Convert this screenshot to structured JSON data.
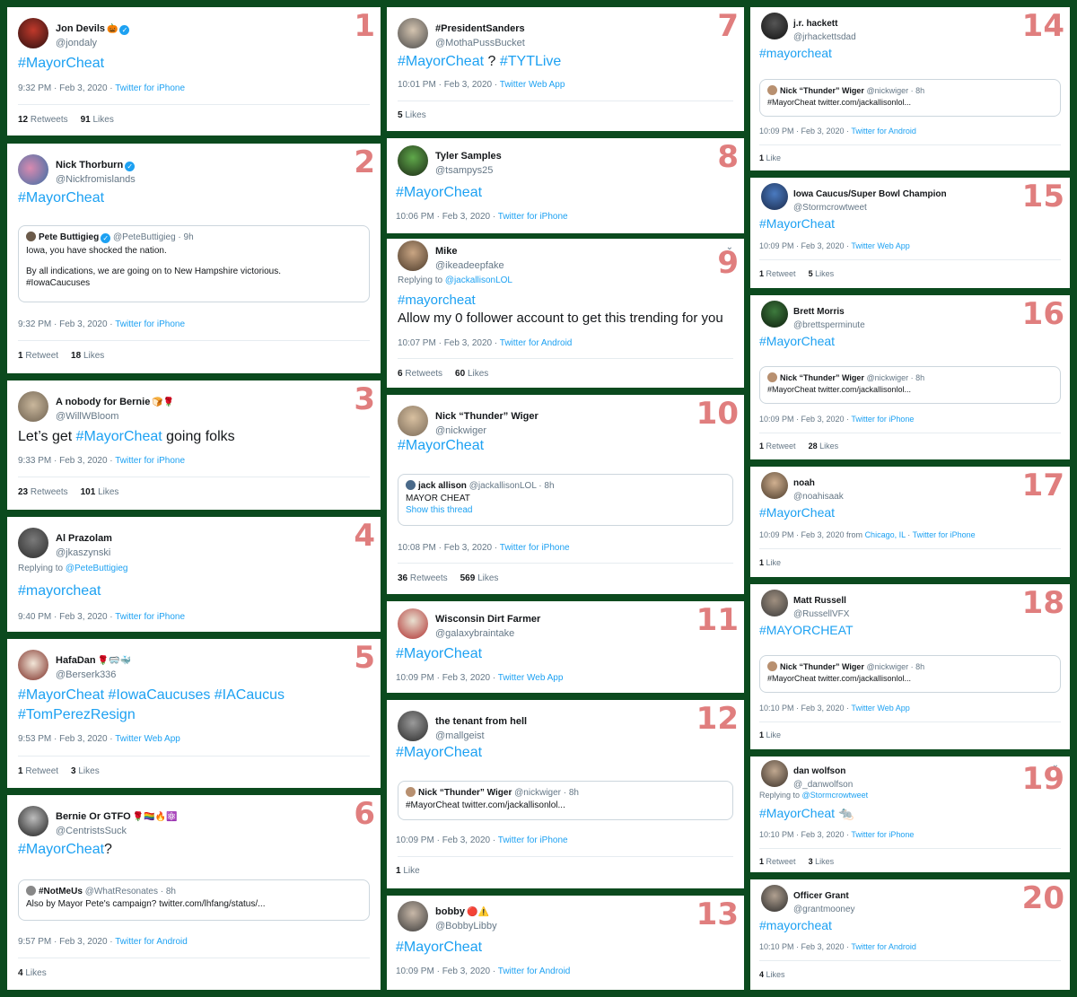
{
  "tweets": [
    {
      "n": "1",
      "name": "Jon Devils",
      "emoji": "🎃",
      "verified": true,
      "handle": "@jondaly",
      "text": "#MayorCheat",
      "time": "9:32 PM · Feb 3, 2020 · ",
      "source": "Twitter for iPhone",
      "retweets": "12",
      "retweets_label": "Retweets",
      "likes": "91",
      "likes_label": "Likes"
    },
    {
      "n": "2",
      "name": "Nick Thorburn",
      "verified": true,
      "handle": "@Nickfromislands",
      "text": "#MayorCheat",
      "quote": {
        "name": "Pete Buttigieg",
        "handle": "@PeteButtigieg · 9h",
        "line1": "Iowa, you have shocked the nation.",
        "line2": "By all indications, we are going on to New Hampshire victorious.",
        "line3": "#IowaCaucuses"
      },
      "time": "9:32 PM · Feb 3, 2020 · ",
      "source": "Twitter for iPhone",
      "retweets": "1",
      "retweets_label": "Retweet",
      "likes": "18",
      "likes_label": "Likes"
    },
    {
      "n": "3",
      "name": "A nobody for Bernie",
      "emoji": "🍞🌹",
      "handle": "@WillWBloom",
      "pre": "Let’s get ",
      "text": "#MayorCheat",
      "post": " going folks",
      "time": "9:33 PM · Feb 3, 2020 · ",
      "source": "Twitter for iPhone",
      "retweets": "23",
      "retweets_label": "Retweets",
      "likes": "101",
      "likes_label": "Likes"
    },
    {
      "n": "4",
      "name": "Al Prazolam",
      "handle": "@jkaszynski",
      "reply_label": "Replying to ",
      "reply_to": "@PeteButtigieg",
      "text": "#mayorcheat",
      "time": "9:40 PM · Feb 3, 2020 · ",
      "source": "Twitter for iPhone"
    },
    {
      "n": "5",
      "name": "HafaDan",
      "emoji": "🌹🥽🐳",
      "handle": "@Berserk336",
      "text": "#MayorCheat #IowaCaucuses #IACaucus",
      "text2": "#TomPerezResign",
      "time": "9:53 PM · Feb 3, 2020 · ",
      "source": "Twitter Web App",
      "retweets": "1",
      "retweets_label": "Retweet",
      "likes": "3",
      "likes_label": "Likes"
    },
    {
      "n": "6",
      "name": "Bernie Or GTFO",
      "emoji": "🌹🏳️‍🌈🔥⚛️",
      "handle": "@CentristsSuck",
      "text": "#MayorCheat",
      "post": "?",
      "quote": {
        "name": "#NotMeUs",
        "handle": "@WhatResonates · 8h",
        "line1": "Also by Mayor Pete's campaign? twitter.com/lhfang/status/..."
      },
      "time": "9:57 PM · Feb 3, 2020 · ",
      "source": "Twitter for Android",
      "likes": "4",
      "likes_label": "Likes"
    },
    {
      "n": "7",
      "name": "#PresidentSanders",
      "handle": "@MothaPussBucket",
      "text": "#MayorCheat",
      "mid": " ? ",
      "text_b": "#TYTLive",
      "time": "10:01 PM · Feb 3, 2020 · ",
      "source": "Twitter Web App",
      "likes": "5",
      "likes_label": "Likes"
    },
    {
      "n": "8",
      "name": "Tyler Samples",
      "handle": "@tsampys25",
      "text": "#MayorCheat",
      "time": "10:06 PM · Feb 3, 2020 · ",
      "source": "Twitter for iPhone"
    },
    {
      "n": "9",
      "name": "Mike",
      "handle": "@ikeadeepfake",
      "reply_label": "Replying to ",
      "reply_to": "@jackallisonLOL",
      "text": "#mayorcheat",
      "text2_plain": "Allow my 0 follower account to get this trending for you",
      "time": "10:07 PM · Feb 3, 2020 · ",
      "source": "Twitter for Android",
      "retweets": "6",
      "retweets_label": "Retweets",
      "likes": "60",
      "likes_label": "Likes"
    },
    {
      "n": "10",
      "name": "Nick “Thunder” Wiger",
      "handle": "@nickwiger",
      "text": "#MayorCheat",
      "quote": {
        "name": "jack allison",
        "handle": "@jackallisonLOL · 8h",
        "line1": "MAYOR CHEAT",
        "link": "Show this thread"
      },
      "time": "10:08 PM · Feb 3, 2020 · ",
      "source": "Twitter for iPhone",
      "retweets": "36",
      "retweets_label": "Retweets",
      "likes": "569",
      "likes_label": "Likes"
    },
    {
      "n": "11",
      "name": "Wisconsin Dirt Farmer",
      "handle": "@galaxybraintake",
      "text": "#MayorCheat",
      "time": "10:09 PM · Feb 3, 2020 · ",
      "source": "Twitter Web App"
    },
    {
      "n": "12",
      "name": "the tenant from hell",
      "handle": "@mallgeist",
      "text": "#MayorCheat",
      "quote": {
        "name": "Nick “Thunder” Wiger",
        "handle": "@nickwiger · 8h",
        "line1": "#MayorCheat twitter.com/jackallisonlol..."
      },
      "time": "10:09 PM · Feb 3, 2020 · ",
      "source": "Twitter for iPhone",
      "likes": "1",
      "likes_label": "Like"
    },
    {
      "n": "13",
      "name": "bobby",
      "emoji": "🔴⚠️",
      "handle": "@BobbyLibby",
      "text": "#MayorCheat",
      "time": "10:09 PM · Feb 3, 2020 · ",
      "source": "Twitter for Android"
    },
    {
      "n": "14",
      "name": "j.r. hackett",
      "handle": "@jrhackettsdad",
      "text": "#mayorcheat",
      "quote": {
        "name": "Nick “Thunder” Wiger",
        "handle": "@nickwiger · 8h",
        "line1": "#MayorCheat twitter.com/jackallisonlol..."
      },
      "time": "10:09 PM · Feb 3, 2020 · ",
      "source": "Twitter for Android",
      "likes": "1",
      "likes_label": "Like"
    },
    {
      "n": "15",
      "name": "Iowa Caucus/Super Bowl Champion",
      "handle": "@Stormcrowtweet",
      "text": "#MayorCheat",
      "time": "10:09 PM · Feb 3, 2020 · ",
      "source": "Twitter Web App",
      "retweets": "1",
      "retweets_label": "Retweet",
      "likes": "5",
      "likes_label": "Likes"
    },
    {
      "n": "16",
      "name": "Brett Morris",
      "handle": "@brettsperminute",
      "text": "#MayorCheat",
      "quote": {
        "name": "Nick “Thunder” Wiger",
        "handle": "@nickwiger · 8h",
        "line1": "#MayorCheat twitter.com/jackallisonlol..."
      },
      "time": "10:09 PM · Feb 3, 2020 · ",
      "source": "Twitter for iPhone",
      "retweets": "1",
      "retweets_label": "Retweet",
      "likes": "28",
      "likes_label": "Likes"
    },
    {
      "n": "17",
      "name": "noah",
      "handle": "@noahisaak",
      "text": "#MayorCheat",
      "time": "10:09 PM · Feb 3, 2020 from ",
      "loc": "Chicago, IL",
      "time2": " · ",
      "source": "Twitter for iPhone",
      "likes": "1",
      "likes_label": "Like"
    },
    {
      "n": "18",
      "name": "Matt Russell",
      "handle": "@RussellVFX",
      "text": "#MAYORCHEAT",
      "quote": {
        "name": "Nick “Thunder” Wiger",
        "handle": "@nickwiger · 8h",
        "line1": "#MayorCheat twitter.com/jackallisonlol..."
      },
      "time": "10:10 PM · Feb 3, 2020 · ",
      "source": "Twitter Web App",
      "likes": "1",
      "likes_label": "Like"
    },
    {
      "n": "19",
      "name": "dan wolfson",
      "handle": "@_danwolfson",
      "reply_label": "Replying to ",
      "reply_to": "@Stormcrowtweet",
      "text": "#MayorCheat",
      "emoji_text": "🐀",
      "time": "10:10 PM · Feb 3, 2020 · ",
      "source": "Twitter for iPhone",
      "retweets": "1",
      "retweets_label": "Retweet",
      "likes": "3",
      "likes_label": "Likes"
    },
    {
      "n": "20",
      "name": "Officer Grant",
      "handle": "@grantmooney",
      "text": "#mayorcheat",
      "time": "10:10 PM · Feb 3, 2020 · ",
      "source": "Twitter for Android",
      "likes": "4",
      "likes_label": "Likes"
    }
  ],
  "icons": {
    "verified": "verified-check-icon",
    "caret": "chevron-down-icon"
  },
  "colors": {
    "background": "#0b4a1e",
    "link": "#1da1f2",
    "number": "#e07e7e",
    "muted": "#657786"
  }
}
